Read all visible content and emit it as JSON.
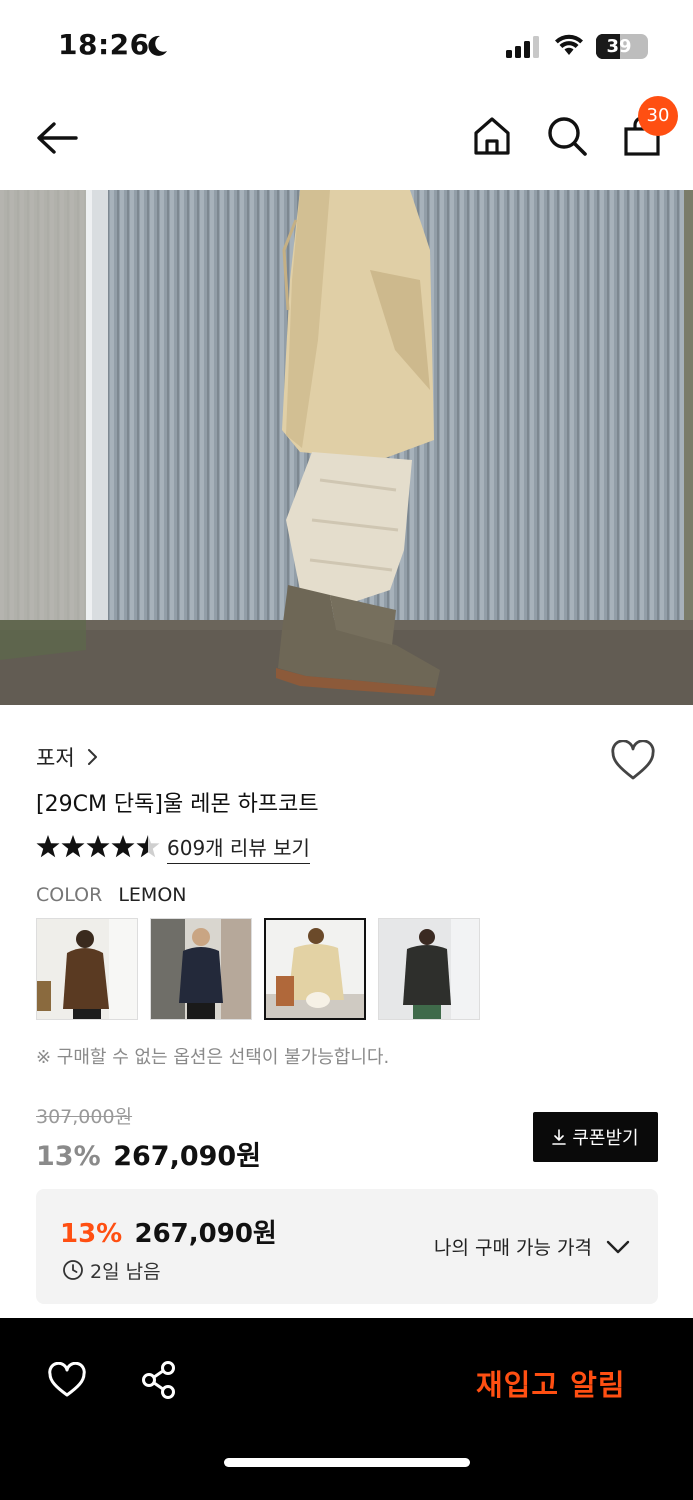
{
  "status_bar": {
    "time": "18:26",
    "battery_percent": "39",
    "battery_level": 0.39
  },
  "nav": {
    "cart_count": "30"
  },
  "product": {
    "brand": "포저",
    "title": "[29CM 단독]울 레몬 하프코트",
    "rating": 4.5,
    "review_link": "609개 리뷰 보기",
    "color_label": "COLOR",
    "color_value": "LEMON",
    "swatches": [
      {
        "name": "brown",
        "color": "#5a3a22"
      },
      {
        "name": "navy",
        "color": "#23293a"
      },
      {
        "name": "lemon",
        "color": "#e3d2a4",
        "selected": true
      },
      {
        "name": "charcoal",
        "color": "#2e2f2c"
      }
    ],
    "notice": "※ 구매할 수 없는 옵션은 선택이 불가능합니다.",
    "original_price": "307,000원",
    "discount": "13%",
    "price": "267,090원",
    "coupon_label": "쿠폰받기"
  },
  "my_price": {
    "discount": "13%",
    "price": "267,090원",
    "remaining": "2일 남음",
    "link_label": "나의 구매 가능 가격"
  },
  "bottom_bar": {
    "restock_label": "재입고 알림"
  },
  "colors": {
    "accent": "#ff4f12",
    "black": "#000000",
    "box_bg": "#f3f3f3"
  }
}
